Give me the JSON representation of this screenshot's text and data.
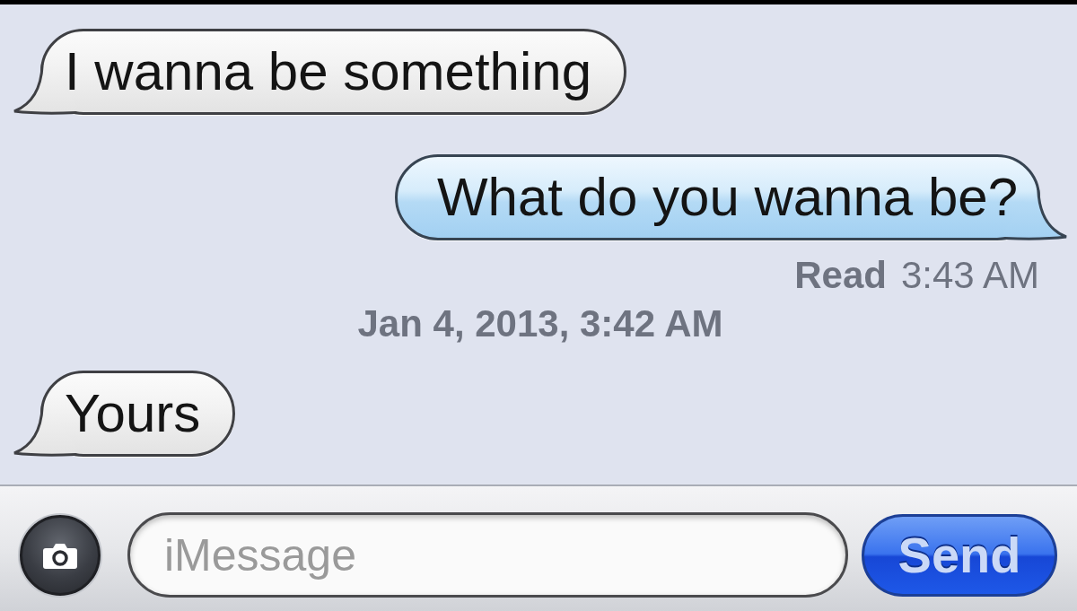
{
  "messages": [
    {
      "kind": "received",
      "text": "I wanna be something"
    },
    {
      "kind": "sent",
      "text": "What do you wanna be?",
      "receipt": {
        "status": "Read",
        "time": "3:43 AM"
      }
    },
    {
      "kind": "timestamp",
      "text": "Jan 4, 2013, 3:42 AM"
    },
    {
      "kind": "received",
      "text": "Yours"
    }
  ],
  "compose": {
    "placeholder": "iMessage",
    "send": "Send"
  }
}
